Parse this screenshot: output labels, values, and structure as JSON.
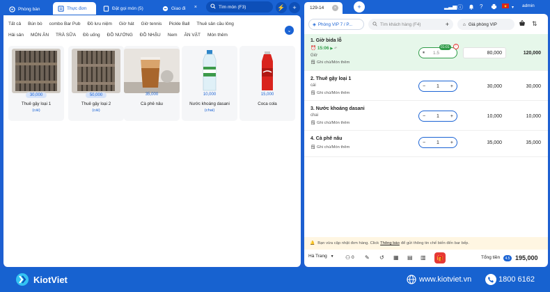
{
  "tabs": {
    "rooms": "Phòng bàn",
    "menu": "Thực đơn",
    "orders": "Đặt gọi món (5)",
    "delivery": "Giao đi"
  },
  "search": {
    "placeholder": "Tìm món (F3)"
  },
  "order_tab": "129-14",
  "admin": "admin",
  "categories_row1": [
    "Tất cả",
    "Bún bò",
    "combo Bar Pub",
    "Đồ lưu niệm",
    "Giờ hát",
    "Giờ tennis",
    "Pickle Ball",
    "Thuê sân cầu lông"
  ],
  "categories_row2": [
    "Hải sản",
    "MÓN ĂN",
    "TRÀ SỮA",
    "Đồ uống",
    "ĐỒ NƯỚNG",
    "ĐỒ NHẬU",
    "Nem",
    "ĂN VẶT",
    "Món thêm"
  ],
  "products": [
    {
      "price": "30,000",
      "name": "Thuê gậy loại 1",
      "unit": "(cái)"
    },
    {
      "price": "50,000",
      "name": "Thuê gậy loại 2",
      "unit": "(cái)"
    },
    {
      "price": "35,000",
      "name": "Cà phê nâu",
      "unit": ""
    },
    {
      "price": "10,000",
      "name": "Nước khoáng dasani",
      "unit": "(chai)"
    },
    {
      "price": "15,000",
      "name": "Coca cola",
      "unit": ""
    }
  ],
  "order_header": {
    "room": "Phòng VIP 7 / P...",
    "customer_placeholder": "Tìm khách hàng (F4)",
    "price_list": "Giá phòng VIP"
  },
  "order_items": [
    {
      "name": "1. Giờ bida lỗ",
      "unit": "Giờ",
      "time": "15:06",
      "timer": "01:01",
      "qty": "1.5",
      "price": "80,000",
      "total": "120,000",
      "note": "Ghi chú/Món thêm"
    },
    {
      "name": "2. Thuê gậy loại 1",
      "unit": "cái",
      "qty": "1",
      "price": "30,000",
      "total": "30,000",
      "note": "Ghi chú/Món thêm"
    },
    {
      "name": "3. Nước khoáng dasani",
      "unit": "chai",
      "qty": "1",
      "price": "10,000",
      "total": "10,000",
      "note": "Ghi chú/Món thêm"
    },
    {
      "name": "4. Cà phê nâu",
      "unit": "",
      "qty": "1",
      "price": "35,000",
      "total": "35,000",
      "note": "Ghi chú/Món thêm"
    }
  ],
  "notice": {
    "before": "Bạn vừa cập nhật đơn hàng. Click",
    "link": "Thông báo",
    "after": "để gửi thông tin chế biến đến bar bếp."
  },
  "footer": {
    "staff": "Hà Trang",
    "guests": "0",
    "total_label": "Tổng tiền",
    "total_badge": "4.5",
    "total_value": "195,000"
  },
  "brand": {
    "name": "KiotViet",
    "website": "www.kiotviet.vn",
    "phone": "1800 6162"
  },
  "colors": {
    "primary": "#1a63d4",
    "highlight_row": "#e6f7ea",
    "notice_bg": "#fff6e2",
    "gift": "#e53935"
  }
}
